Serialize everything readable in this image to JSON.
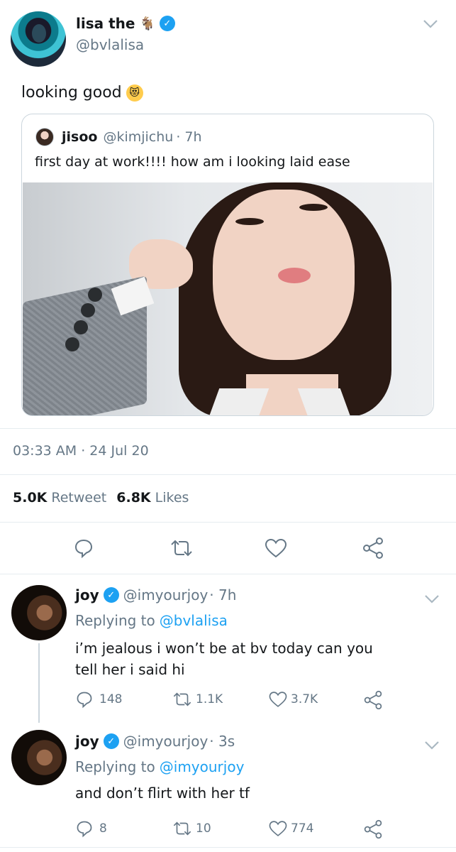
{
  "main_tweet": {
    "display_name": "lisa the",
    "name_emoji": "🐐",
    "handle": "@bvlalisa",
    "text": "looking good",
    "text_emoji": "😻",
    "quote": {
      "display_name": "jisoo",
      "handle": "@kimjichu",
      "time": "· 7h",
      "text": "first day at work!!!! how am i looking laid ease"
    },
    "timestamp": "03:33 AM · 24 Jul 20",
    "retweet_count": "5.0K",
    "retweet_label": "Retweet",
    "like_count": "6.8K",
    "like_label": "Likes"
  },
  "replies": [
    {
      "display_name": "joy",
      "handle": "@imyourjoy",
      "time": "· 7h",
      "replying_prefix": "Replying to",
      "replying_to": "@bvlalisa",
      "text": "i’m jealous i won’t be at bv today can you tell her i said hi",
      "replies": "148",
      "retweets": "1.1K",
      "likes": "3.7K"
    },
    {
      "display_name": "joy",
      "handle": "@imyourjoy",
      "time": "· 3s",
      "replying_prefix": "Replying to",
      "replying_to": "@imyourjoy",
      "text": "and don’t flirt with her tf",
      "replies": "8",
      "retweets": "10",
      "likes": "774"
    }
  ],
  "icons": [
    "verified-badge-icon",
    "chevron-down-icon",
    "reply-icon",
    "retweet-icon",
    "like-icon",
    "share-icon"
  ],
  "colors": {
    "accent": "#1da1f2",
    "secondary_text": "#657786",
    "divider": "#e6ecf0"
  }
}
